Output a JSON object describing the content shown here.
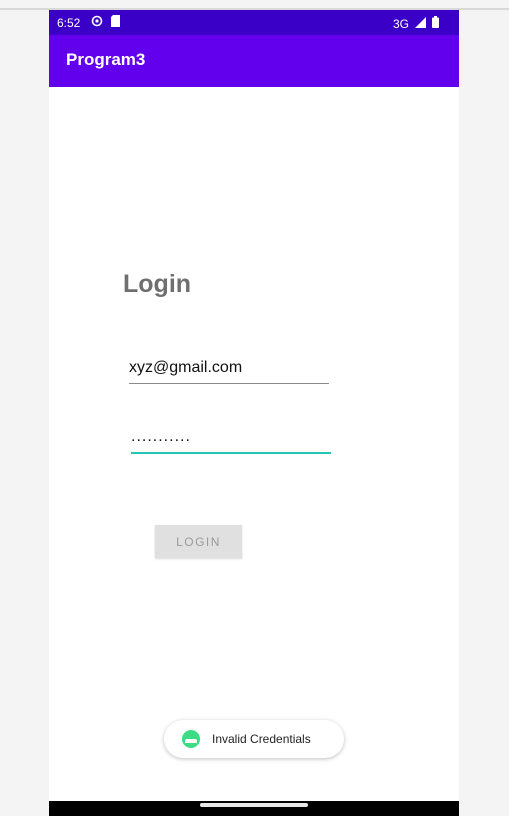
{
  "status_bar": {
    "time": "6:52",
    "network": "3G",
    "icons": [
      "settings-icon",
      "sd-card-icon",
      "signal-icon",
      "battery-icon"
    ]
  },
  "app_bar": {
    "title": "Program3"
  },
  "form": {
    "heading": "Login",
    "email_value": "xyz@gmail.com",
    "password_value": "...........",
    "login_button_label": "LOGIN"
  },
  "toast": {
    "message": "Invalid Credentials",
    "icon": "android-icon"
  },
  "colors": {
    "status_bar": "#3a00c8",
    "app_bar": "#6200ee",
    "input_focus": "#26c6b6",
    "button_disabled": "#e0e0e0",
    "android_green": "#3ddc84"
  }
}
